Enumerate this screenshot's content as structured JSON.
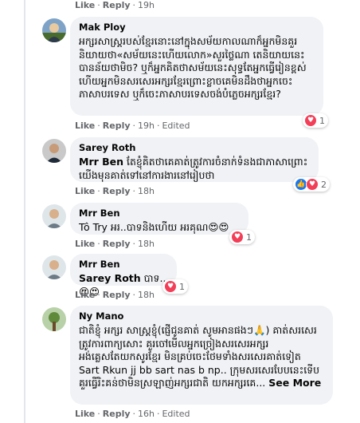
{
  "comments": [
    {
      "id": "top",
      "meta": {
        "like": "Like",
        "reply": "Reply",
        "time": "19h"
      }
    },
    {
      "author": "Mak Ploy",
      "text": "អក្សរសាស្ត្ររបស់ខ្មែរនោះនៅក្នុងសម័យកាលណាក៏អ្នកមិនគួរនិយាយថា«សម័យនេះហើយលោក»សួរថ្លៃណា តេនិយាយនេះបានន័យថាមិច? ឬក៏អ្នកគិតថាសម័យនេះសុទ្ធតែអ្នកធ្វើរៀនខ្ពស់ហើយអ្នកមិនសរសេរអក្សរខ្មែរព្រោះខ្លាចគេមិនដឹងថាអ្នកចេះភាសាបរទេស ឬក៏ចេះភាសាបរទេសចង់បំភ្លេចអក្សរខ្មែរ?",
      "meta": {
        "like": "Like",
        "reply": "Reply",
        "time": "19h",
        "edited": "Edited"
      },
      "reaction_count": "1"
    },
    {
      "author": "Sarey Roth",
      "mention": "Mrr Ben",
      "text": "តែខ្ញុំគិតថាគេគាត់ត្រូវការចំនាក់ទំនងជាភាសាព្រោះយើងមុនគាត់ទៅនៅការងារនៅរៀបថា",
      "meta": {
        "like": "Like",
        "reply": "Reply",
        "time": "18h"
      },
      "reaction_count": "2"
    },
    {
      "author": "Mrr Ben",
      "text": "Tô Try អរ..បាទនិងហើយ អរគុណ😍😍",
      "meta": {
        "like": "Like",
        "reply": "Reply",
        "time": "18h"
      },
      "reaction_count": "1"
    },
    {
      "author": "Mrr Ben",
      "mention": "Sarey Roth",
      "text": "បាទ..😍😍",
      "meta": {
        "like": "Like",
        "reply": "Reply",
        "time": "18h"
      },
      "reaction_count": "1"
    },
    {
      "author": "Ny Mano",
      "text": "ជាតិខ្ញុំ អក្សរ សាស្ត្រខ្ញុំ(ផ្ញើជូនគាត់ សូមអានផងៗ🙏) គាត់សរសេរត្រូវការពាក្យសោះ គួរចៅមើលអ្នកច្រៀងសរសេរអក្សរអង់គ្លេសតែយកសូរខ្មែរ មិនគ្រប់ចេះថែមទាំងសរសេរគាត់ទៀត Sart Rkun jj bb sart nas b np.. ក្រុមសរសេរបែបនេះទើបគួរធ្វើរិះគន់ថាមិនស្រឡាញ់អក្សរជាតិ យកអក្សរគេ...",
      "see_more": "See More",
      "meta": {
        "like": "Like",
        "reply": "Reply",
        "time": "16h",
        "edited": "Edited"
      }
    }
  ]
}
